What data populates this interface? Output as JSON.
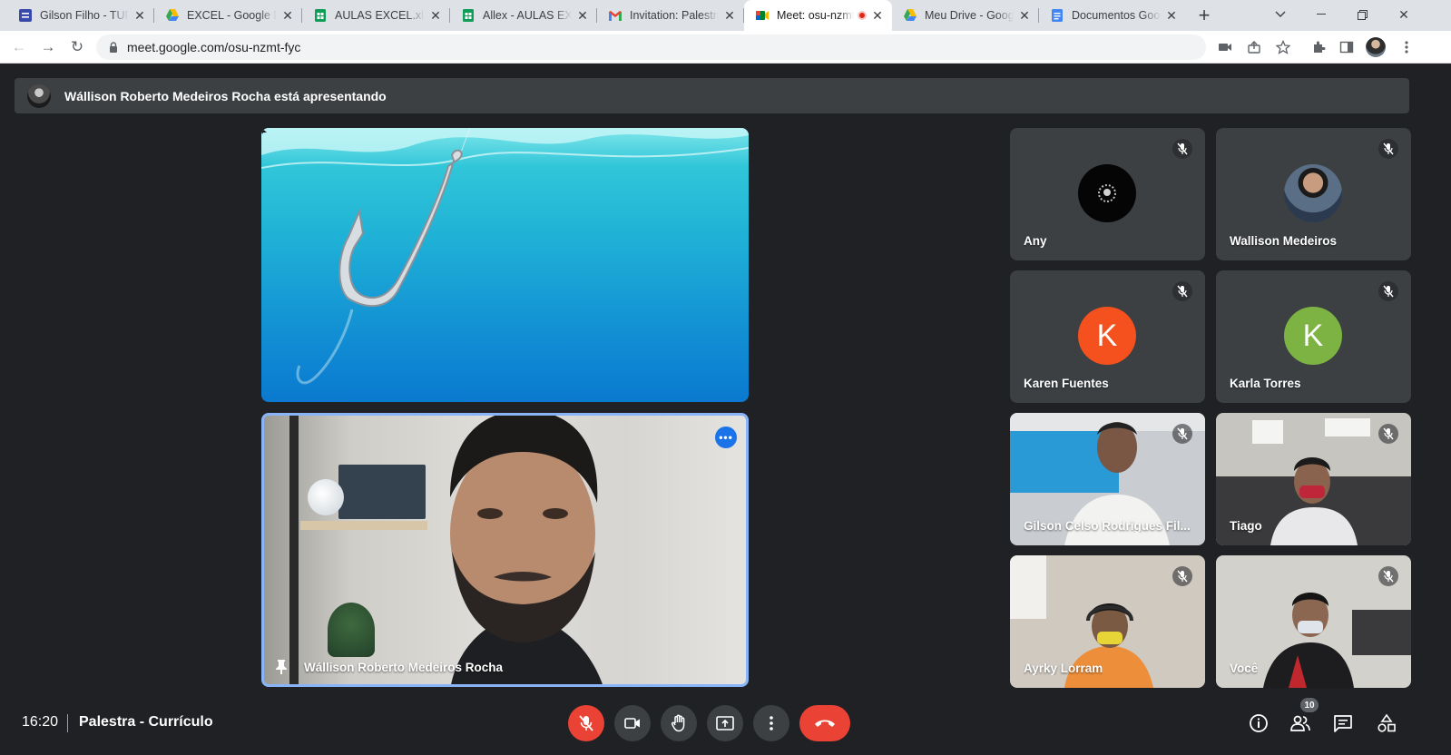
{
  "browser": {
    "tabs": [
      {
        "title": "Gilson Filho - TURMA",
        "icon": "google-forms-icon"
      },
      {
        "title": "EXCEL - Google Drive",
        "icon": "google-drive-icon"
      },
      {
        "title": "AULAS EXCEL.xlsx - Google",
        "icon": "google-sheets-icon"
      },
      {
        "title": "Allex - AULAS EXCEL",
        "icon": "google-sheets-icon"
      },
      {
        "title": "Invitation: Palestra",
        "icon": "gmail-icon"
      },
      {
        "title": "Meet: osu-nzmt-fyc",
        "icon": "google-meet-icon",
        "active": true,
        "recording": true
      },
      {
        "title": "Meu Drive - Google Drive",
        "icon": "google-drive-icon"
      },
      {
        "title": "Documentos Google",
        "icon": "google-docs-icon"
      }
    ],
    "url": "meet.google.com/osu-nzmt-fyc"
  },
  "meet": {
    "presenting_text": "Wállison Roberto Medeiros Rocha está apresentando",
    "speaker_name": "Wállison Roberto Medeiros Rocha",
    "participants": [
      {
        "name": "Any",
        "type": "avatar-image",
        "muted": true
      },
      {
        "name": "Wallison Medeiros",
        "type": "avatar-image",
        "muted": true
      },
      {
        "name": "Karen Fuentes",
        "type": "initial",
        "initial": "K",
        "color": "#f4511e",
        "muted": true
      },
      {
        "name": "Karla Torres",
        "type": "initial",
        "initial": "K",
        "color": "#7cb342",
        "muted": true
      },
      {
        "name": "Gilson Celso Rodrigues Fil...",
        "type": "video",
        "muted": true
      },
      {
        "name": "Tiago",
        "type": "video",
        "muted": true
      },
      {
        "name": "Ayrky Lorram",
        "type": "video",
        "muted": true
      },
      {
        "name": "Você",
        "type": "video",
        "muted": true
      }
    ],
    "time": "16:20",
    "meeting_title": "Palestra - Currículo",
    "participant_count": "10",
    "colors": {
      "background": "#202124",
      "tile": "#3c4043",
      "accent": "#8ab4f8",
      "danger": "#ea4335"
    }
  }
}
